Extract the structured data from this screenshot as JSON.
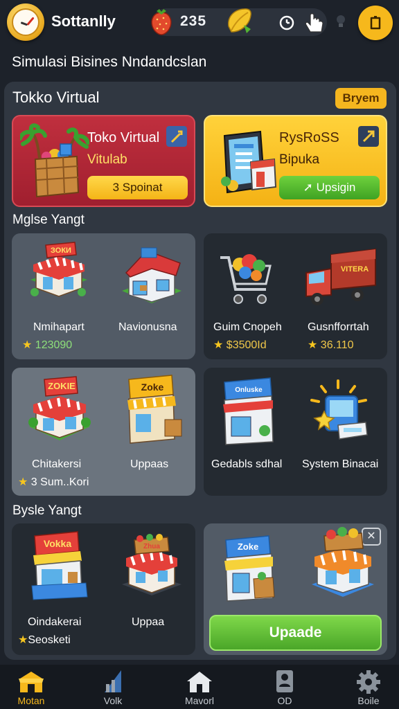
{
  "header": {
    "app_name": "Sottanlly",
    "coins": "235"
  },
  "subtitle": "Simulasi Bisines Nndandcslan",
  "panel": {
    "title": "Tokko Virtual",
    "badge": "Bryem"
  },
  "hero_cards": [
    {
      "title": "Toko Virtual",
      "subtitle": "Vitulab",
      "button": "3 Spoinat"
    },
    {
      "title": "RysRoSS",
      "subtitle": "Bipuka",
      "button": "Upsigin"
    }
  ],
  "sections": {
    "first": "Mglse Yangt",
    "second": "Bysle Yangt"
  },
  "items": [
    {
      "label": "Nmihapart",
      "value": "123090"
    },
    {
      "label": "Navionusna",
      "value": ""
    },
    {
      "label": "Guim Cnopeh",
      "value": "$3500Id"
    },
    {
      "label": "Gusnfforrtah",
      "value": "36.110"
    },
    {
      "label": "Chitakersi",
      "value": "3 Sum..Kori"
    },
    {
      "label": "Uppaas",
      "value": ""
    },
    {
      "label": "Gedabls sdhal",
      "value": ""
    },
    {
      "label": "System Binacai",
      "value": ""
    },
    {
      "label": "Oindakerai",
      "value": "Seosketi"
    },
    {
      "label": "Uppaa",
      "value": ""
    }
  ],
  "upgrade_button": "Upaade",
  "close_symbol": "✕",
  "sign_texts": {
    "shop1": "ЗОКИ",
    "shop3": "ZOKIE",
    "shop4": "Zoke",
    "shop5": "Onluske",
    "shop6": "Vokka",
    "shop7": "Zoke",
    "truck": "VITERA"
  },
  "bottom_nav": [
    {
      "label": "Motan",
      "icon": "shop-icon",
      "active": true
    },
    {
      "label": "Volk",
      "icon": "chart-icon",
      "active": false
    },
    {
      "label": "Mavorl",
      "icon": "home-icon",
      "active": false
    },
    {
      "label": "OD",
      "icon": "profile-icon",
      "active": false
    },
    {
      "label": "Boile",
      "icon": "gear-icon",
      "active": false
    }
  ],
  "colors": {
    "background": "#1d222a",
    "panel": "#303741",
    "accent_yellow": "#f6b81c",
    "hero_red": "#b3273a",
    "button_green": "#4aa628"
  }
}
